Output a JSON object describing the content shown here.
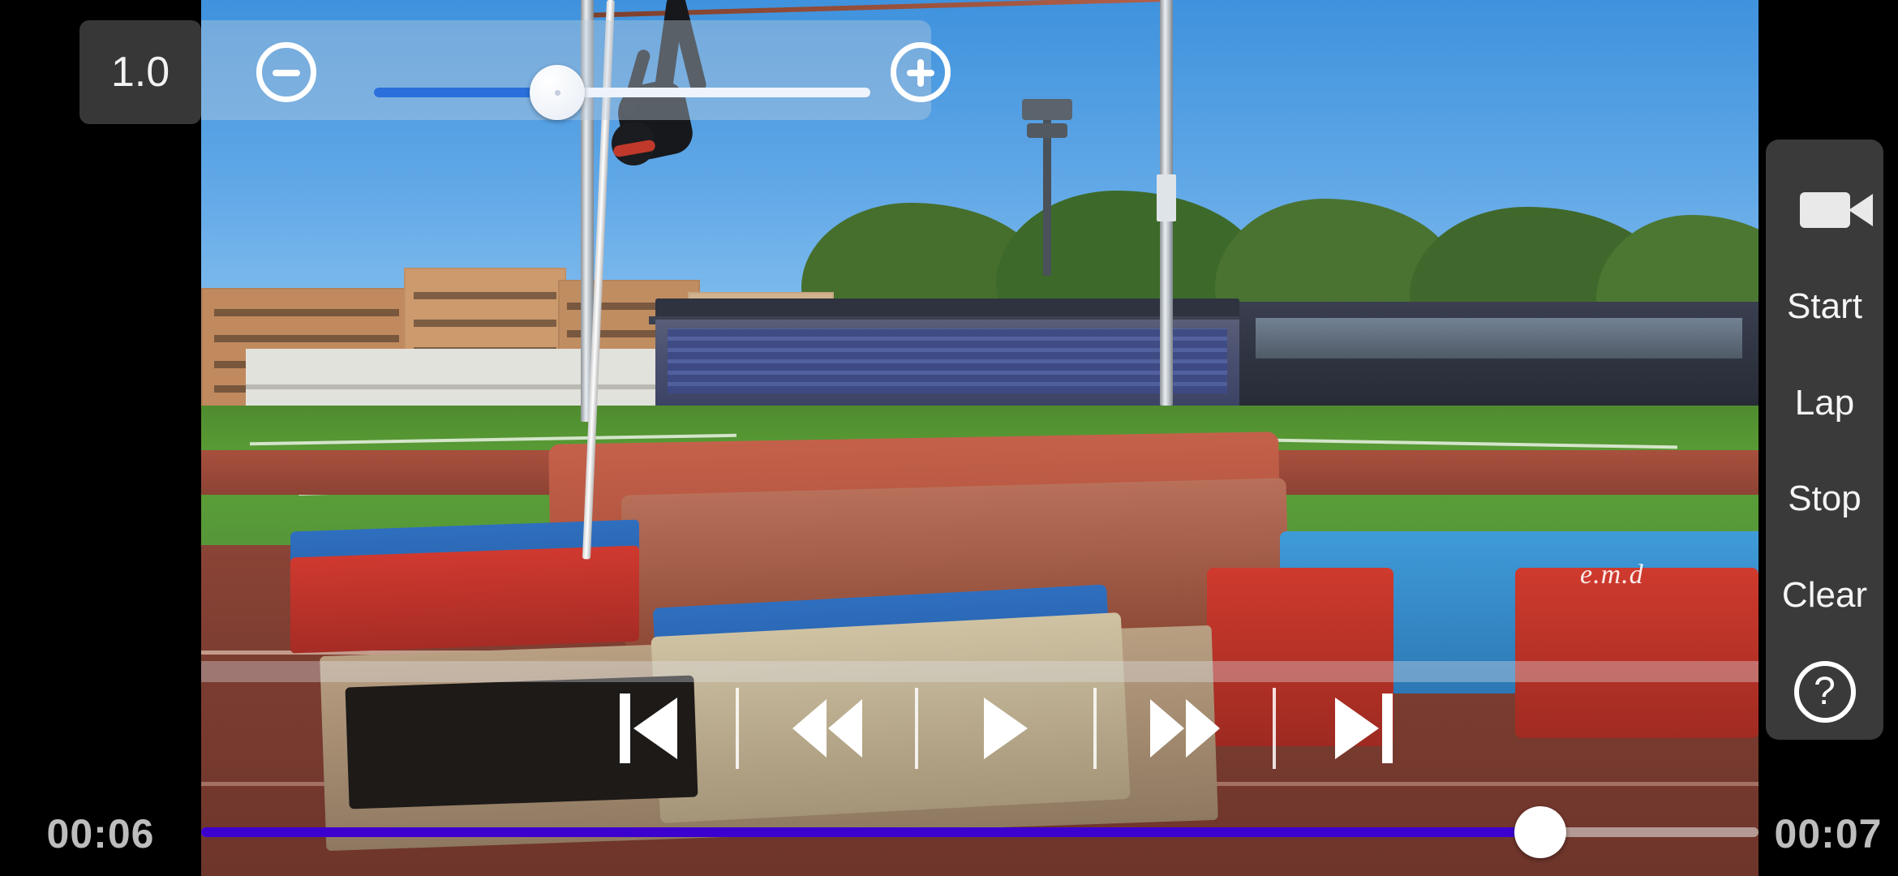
{
  "app": {
    "type": "video-playback-analysis"
  },
  "speed_control": {
    "value_label": "1.0",
    "decrease_icon": "minus-circle-icon",
    "increase_icon": "plus-circle-icon",
    "slider": {
      "fill_percent": 37,
      "thumb_percent": 37
    },
    "fill_color": "#2a6fdb",
    "track_color": "#eef3fc"
  },
  "transport": {
    "buttons": [
      {
        "name": "skip-to-start-button",
        "icon": "skip-previous-icon"
      },
      {
        "name": "rewind-button",
        "icon": "fast-rewind-icon"
      },
      {
        "name": "play-button",
        "icon": "play-icon"
      },
      {
        "name": "fast-forward-button",
        "icon": "fast-forward-icon"
      },
      {
        "name": "skip-to-end-button",
        "icon": "skip-next-icon"
      }
    ]
  },
  "timeline": {
    "current_time": "00:06",
    "total_time": "00:07",
    "progress_percent": 86,
    "fill_color": "#3c00cf"
  },
  "sidebar": {
    "items": [
      {
        "name": "record-icon",
        "label": "",
        "icon": "video-camera-icon"
      },
      {
        "name": "start-button",
        "label": "Start"
      },
      {
        "name": "lap-button",
        "label": "Lap"
      },
      {
        "name": "stop-button",
        "label": "Stop"
      },
      {
        "name": "clear-button",
        "label": "Clear"
      },
      {
        "name": "help-button",
        "label": "?",
        "icon": "question-mark-circle-icon"
      }
    ],
    "labels": {
      "start": "Start",
      "lap": "Lap",
      "stop": "Stop",
      "clear": "Clear",
      "help": "?"
    },
    "background_color": "#3a3a3a"
  },
  "video": {
    "scene_text": "e.m.d"
  }
}
